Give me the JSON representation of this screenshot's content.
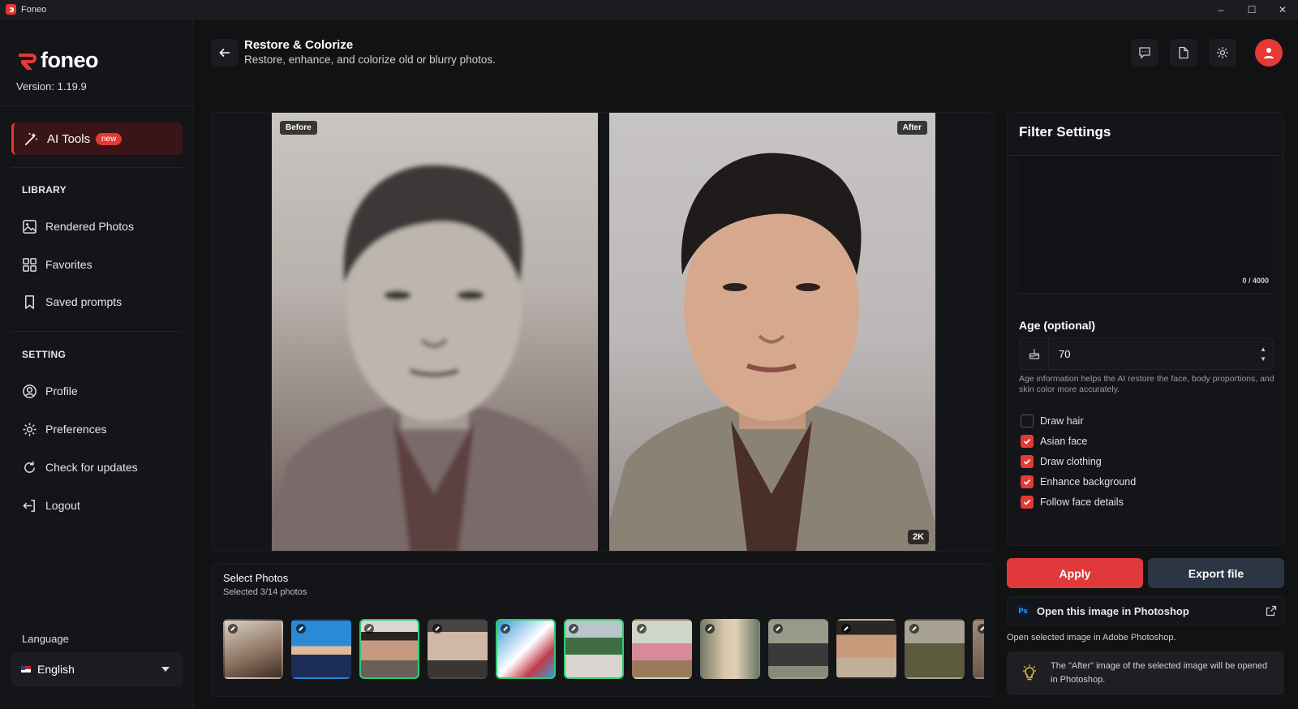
{
  "window": {
    "title": "Foneo",
    "controls": [
      "–",
      "☐",
      "✕"
    ]
  },
  "brand": {
    "name": "foneo",
    "version": "Version: 1.19.9"
  },
  "sidebar": {
    "ai_tools": {
      "label": "AI Tools",
      "badge": "new"
    },
    "library": {
      "title": "LIBRARY",
      "items": [
        {
          "label": "Rendered Photos",
          "icon": "image-icon"
        },
        {
          "label": "Favorites",
          "icon": "grid-icon"
        },
        {
          "label": "Saved prompts",
          "icon": "bookmark-icon"
        }
      ]
    },
    "setting": {
      "title": "SETTING",
      "items": [
        {
          "label": "Profile",
          "icon": "user-circle-icon"
        },
        {
          "label": "Preferences",
          "icon": "gear-icon"
        },
        {
          "label": "Check for updates",
          "icon": "refresh-icon"
        },
        {
          "label": "Logout",
          "icon": "logout-icon"
        }
      ]
    },
    "language": {
      "label": "Language",
      "selected": "English"
    }
  },
  "header": {
    "title": "Restore & Colorize",
    "subtitle": "Restore, enhance, and colorize old or blurry photos.",
    "actions": [
      "chat-icon",
      "file-icon",
      "gear-icon",
      "user-icon"
    ]
  },
  "preview": {
    "before_label": "Before",
    "after_label": "After",
    "resolution_badge": "2K"
  },
  "select_photos": {
    "title": "Select Photos",
    "subtitle": "Selected 3/14 photos",
    "selected_indices": [
      2,
      4,
      5
    ]
  },
  "filters": {
    "title": "Filter Settings",
    "prompt_counter": "0 / 4000",
    "age": {
      "label": "Age (optional)",
      "value": "70",
      "help": "Age information helps the AI restore the face, body proportions, and skin color more accurately."
    },
    "options": [
      {
        "label": "Draw hair",
        "checked": false
      },
      {
        "label": "Asian face",
        "checked": true
      },
      {
        "label": "Draw clothing",
        "checked": true
      },
      {
        "label": "Enhance background",
        "checked": true
      },
      {
        "label": "Follow face details",
        "checked": true
      }
    ]
  },
  "actions": {
    "apply": "Apply",
    "export": "Export file"
  },
  "photoshop": {
    "icon_text": "Ps",
    "label": "Open this image in Photoshop",
    "description": "Open selected image in Adobe Photoshop.",
    "tip": "The \"After\" image of the selected image will be opened in Photoshop."
  },
  "colors": {
    "accent": "#e53935",
    "selected_border": "#2ecc71",
    "export_bg": "#2c3543"
  }
}
